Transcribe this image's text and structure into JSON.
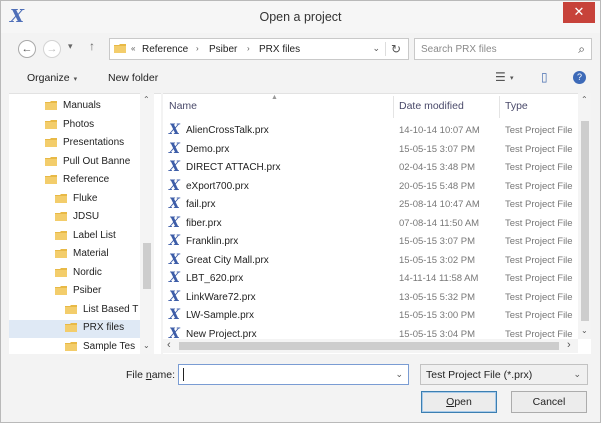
{
  "window": {
    "title": "Open a project",
    "close_glyph": "✕",
    "app_icon": "X"
  },
  "nav_buttons": {
    "back": "←",
    "forward": "→",
    "recent": "▾",
    "up": "↑"
  },
  "address": {
    "overflow": "«",
    "crumbs": [
      "Reference",
      "Psiber",
      "PRX files"
    ],
    "separator": "›",
    "dropdown": "⌄",
    "refresh": "↻"
  },
  "search": {
    "placeholder": "Search PRX files",
    "icon": "search-icon",
    "glyph": "⌕"
  },
  "toolbar": {
    "organize": "Organize",
    "new_folder": "New folder",
    "caret": "▾",
    "views_glyph": "☰",
    "preview_glyph": "▯",
    "help_glyph": "?"
  },
  "nav_tree": [
    {
      "label": "Manuals",
      "indent": 0
    },
    {
      "label": "Photos",
      "indent": 0
    },
    {
      "label": "Presentations",
      "indent": 0
    },
    {
      "label": "Pull Out Banne",
      "indent": 0
    },
    {
      "label": "Reference",
      "indent": 0
    },
    {
      "label": "Fluke",
      "indent": 1
    },
    {
      "label": "JDSU",
      "indent": 1
    },
    {
      "label": "Label List",
      "indent": 1
    },
    {
      "label": "Material",
      "indent": 1
    },
    {
      "label": "Nordic",
      "indent": 1
    },
    {
      "label": "Psiber",
      "indent": 1
    },
    {
      "label": "List Based T",
      "indent": 2
    },
    {
      "label": "PRX files",
      "indent": 2,
      "selected": true
    },
    {
      "label": "Sample Tes",
      "indent": 2
    }
  ],
  "columns": {
    "name": "Name",
    "date": "Date modified",
    "type": "Type"
  },
  "files": [
    {
      "name": "AlienCrossTalk.prx",
      "date": "14-10-14 10:07 AM",
      "type": "Test Project File"
    },
    {
      "name": "Demo.prx",
      "date": "15-05-15 3:07 PM",
      "type": "Test Project File"
    },
    {
      "name": "DIRECT ATTACH.prx",
      "date": "02-04-15 3:48 PM",
      "type": "Test Project File"
    },
    {
      "name": "eXport700.prx",
      "date": "20-05-15 5:48 PM",
      "type": "Test Project File"
    },
    {
      "name": "fail.prx",
      "date": "25-08-14 10:47 AM",
      "type": "Test Project File"
    },
    {
      "name": "fiber.prx",
      "date": "07-08-14 11:50 AM",
      "type": "Test Project File"
    },
    {
      "name": "Franklin.prx",
      "date": "15-05-15 3:07 PM",
      "type": "Test Project File"
    },
    {
      "name": "Great City Mall.prx",
      "date": "15-05-15 3:02 PM",
      "type": "Test Project File"
    },
    {
      "name": "LBT_620.prx",
      "date": "14-11-14 11:58 AM",
      "type": "Test Project File"
    },
    {
      "name": "LinkWare72.prx",
      "date": "13-05-15 5:32 PM",
      "type": "Test Project File"
    },
    {
      "name": "LW-Sample.prx",
      "date": "15-05-15 3:00 PM",
      "type": "Test Project File"
    },
    {
      "name": "New Project.prx",
      "date": "15-05-15 3:04 PM",
      "type": "Test Project File"
    }
  ],
  "file_icon": "X",
  "bottom": {
    "filename_label_prefix": "File ",
    "filename_label_underlined": "n",
    "filename_label_suffix": "ame:",
    "filename_value": "",
    "filetype_value": "Test Project File (*.prx)",
    "open_underlined": "O",
    "open_rest": "pen",
    "cancel": "Cancel",
    "dropdown": "⌄"
  },
  "scroll_arrows": {
    "up": "⌃",
    "down": "⌄",
    "left": "‹",
    "right": "›"
  },
  "colors": {
    "accent": "#3d5da8",
    "close": "#c7423a",
    "selection": "#dfe9f5",
    "folder": "#e8b946"
  }
}
